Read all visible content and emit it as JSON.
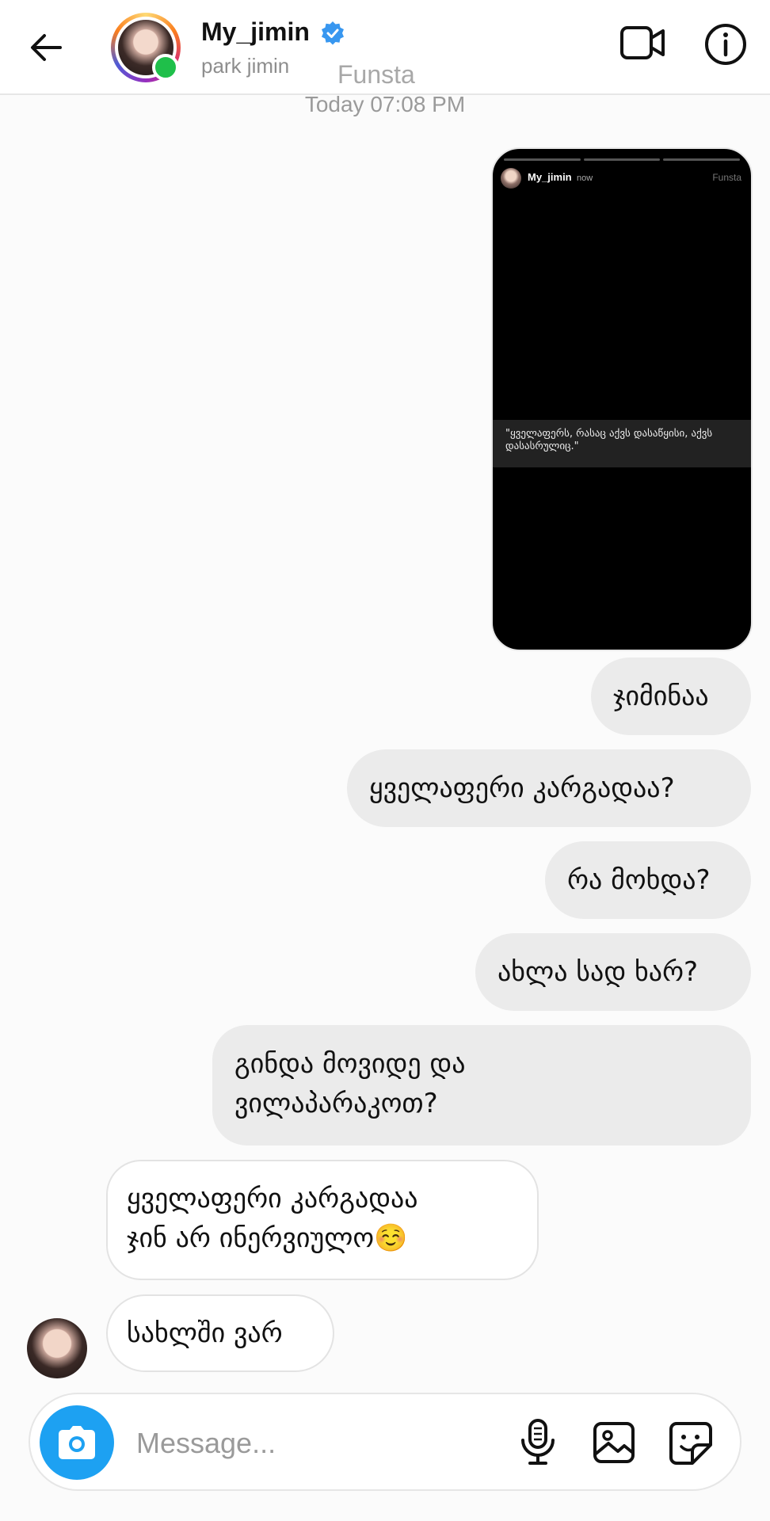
{
  "header": {
    "username": "My_jimin",
    "full_name": "park jimin",
    "watermark": "Funsta",
    "status": "online"
  },
  "timestamp": "Today 07:08 PM",
  "story": {
    "username": "My_jimin",
    "time": "now",
    "tag": "Funsta",
    "quote": "\"ყველაფერს, რასაც აქვს დასაწყისი, აქვს დასასრულიც.\""
  },
  "messages": [
    {
      "direction": "sent",
      "text": "ჯიმინაა"
    },
    {
      "direction": "sent",
      "text": "ყველაფერი კარგადაა?"
    },
    {
      "direction": "sent",
      "text": "რა მოხდა?"
    },
    {
      "direction": "sent",
      "text": "ახლა სად ხარ?"
    },
    {
      "direction": "sent",
      "line1": "გინდა მოვიდე და",
      "line2": "ვილაპარაკოთ?"
    },
    {
      "direction": "received",
      "line1": "ყველაფერი კარგადაა",
      "line2": "ჯინ არ ინერვიულო☺️"
    },
    {
      "direction": "received",
      "text": "სახლში ვარ"
    }
  ],
  "composer": {
    "placeholder": "Message...",
    "value": ""
  },
  "icons": {
    "back": "arrow-left-icon",
    "verified": "verified-badge-icon",
    "video": "video-camera-icon",
    "info": "info-icon",
    "camera": "camera-icon",
    "mic": "microphone-icon",
    "gallery": "image-icon",
    "sticker": "sticker-icon"
  },
  "colors": {
    "accent": "#1da1f2",
    "verified": "#3897f0",
    "online": "#1fbf4a",
    "sent_bubble": "#ebebeb"
  }
}
